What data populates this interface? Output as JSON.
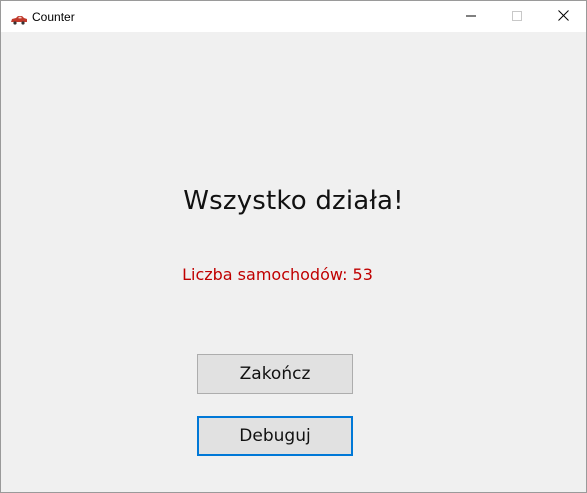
{
  "window": {
    "title": "Counter",
    "icon": "car-icon",
    "controls": [
      "minimize-icon",
      "maximize-icon",
      "close-icon"
    ]
  },
  "main": {
    "heading": "Wszystko działa!",
    "counter_text": "Liczba samochodów: 53",
    "counter_color": "#c00000"
  },
  "buttons": {
    "quit_label": "Zakończ",
    "debug_label": "Debuguj",
    "focus_color": "#0078d7"
  }
}
